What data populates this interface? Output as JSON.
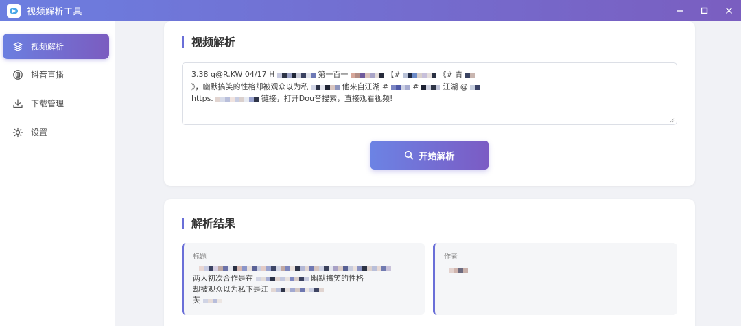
{
  "window": {
    "title": "视频解析工具"
  },
  "sidebar": {
    "items": [
      {
        "label": "视频解析",
        "icon": "layers-icon",
        "active": true
      },
      {
        "label": "抖音直播",
        "icon": "live-badge-icon",
        "active": false
      },
      {
        "label": "下载管理",
        "icon": "download-icon",
        "active": false
      },
      {
        "label": "设置",
        "icon": "gear-icon",
        "active": false
      }
    ]
  },
  "parse_section": {
    "title": "视频解析",
    "link_text": {
      "line1_start": "3.38 q@R.KW 04/17 H",
      "line1_mid": "第一百一",
      "line1_mid2": "【#",
      "line1_end": "《# 青",
      "line2_start": "》，幽默搞笑的性格却被观众以为私",
      "line2_mid": "他来自江湖 #",
      "line2_mid2": "#",
      "line2_mid3": "江湖 @",
      "line3_start": "https.",
      "line3_end": "链接，打开Dou音搜索，直接观看视频!"
    },
    "button_label": "开始解析"
  },
  "result_section": {
    "title": "解析结果",
    "title_field": {
      "label": "标题",
      "value_line1": "两人初次合作是在",
      "value_line1_end": "幽默搞笑的性格",
      "value_line2": "却被观众以为私下是江",
      "value_line3": "芙"
    },
    "author_field": {
      "label": "作者"
    }
  },
  "colors": {
    "accent_start": "#6b7fe0",
    "accent_end": "#7b5cc0",
    "background": "#f1f2f6"
  }
}
